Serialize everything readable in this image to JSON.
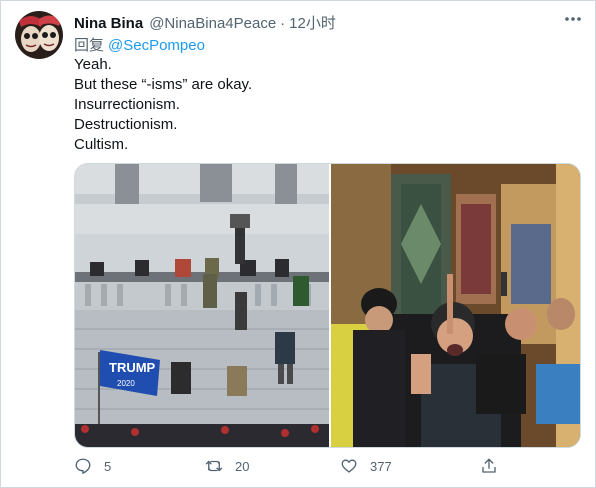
{
  "tweet": {
    "display_name": "Nina Bina",
    "handle": "@NinaBina4Peace",
    "separator": "·",
    "time": "12小时",
    "reply_prefix": "回复",
    "reply_to": "@SecPompeo",
    "lines": [
      "Yeah.",
      "But these “-isms” are okay.",
      "Insurrectionism.",
      "Destructionism.",
      "Cultism."
    ],
    "flag_text": "TRUMP",
    "flag_year": "2020"
  },
  "actions": {
    "replies": "5",
    "retweets": "20",
    "likes": "377"
  },
  "icons": {
    "more": "more-horizontal-icon",
    "reply": "reply-icon",
    "retweet": "retweet-icon",
    "like": "heart-icon",
    "share": "share-icon"
  },
  "colors": {
    "link": "#1d9bf0",
    "secondary": "#536471",
    "border": "#cfd9de"
  }
}
